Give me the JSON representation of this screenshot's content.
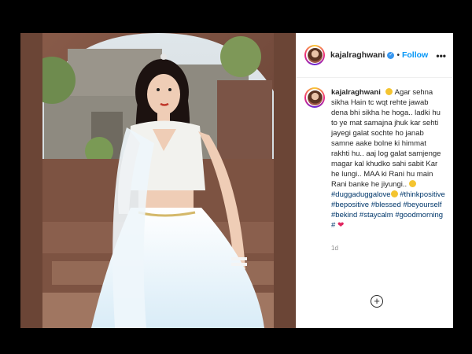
{
  "post": {
    "username": "kajalraghwani",
    "follow_label": "Follow",
    "separator": "•",
    "more_label": "•••",
    "caption": {
      "text_1": "Agar sehna sikha Hain tc wqt rehte jawab dena bhi sikha he hoga.. ladki hu to ye mat samajna jhuk kar sehti jayegi galat sochte ho janab samne aake bolne ki himmat rakhti hu.. aaj log galat samjenge magar kal khudko sahi sabit Kar he lungi.. MAA ki Rani hu main Rani banke he jiyungi..",
      "hashtags": [
        "#duggaduggalove",
        "#thinkpositive",
        "#bepositive",
        "#blessed",
        "#beyourself",
        "#bekind",
        "#staycalm",
        "#goodmorning",
        "#"
      ]
    },
    "timestamp": "1d",
    "add_label": "+"
  },
  "colors": {
    "link": "#0095f6",
    "hashtag": "#00376b",
    "text": "#262626",
    "muted": "#8e8e8e"
  },
  "icons": [
    "verified-badge-icon",
    "more-options-icon",
    "add-comment-icon",
    "heart-icon",
    "emoji-icon"
  ]
}
